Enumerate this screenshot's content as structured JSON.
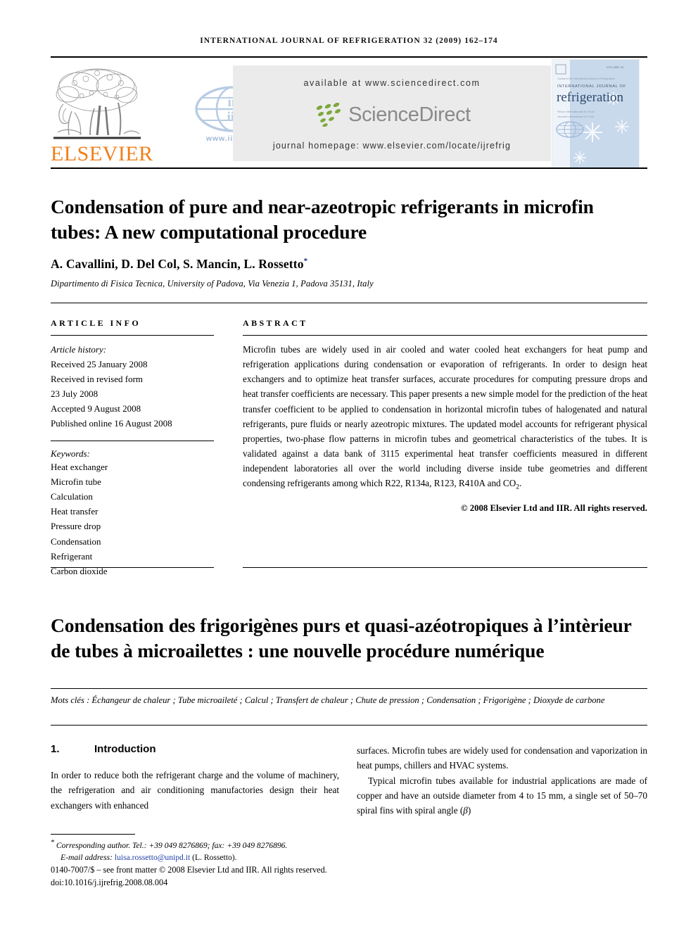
{
  "running_head": "INTERNATIONAL JOURNAL OF REFRIGERATION 32 (2009) 162–174",
  "masthead": {
    "publisher_wordmark": "ELSEVIER",
    "iir_url": "www.iifiir.org",
    "available_at": "available at www.sciencedirect.com",
    "sciencedirect_wordmark": "ScienceDirect",
    "journal_homepage": "journal homepage: www.elsevier.com/locate/ijrefrig",
    "cover": {
      "line_small": "INTERNATIONAL JOURNAL OF",
      "line_big": "refrigeration",
      "volume_tag": "VOLUME 32"
    },
    "colors": {
      "elsevier_orange": "#F07F1A",
      "sciencedirect_green": "#7DA83B",
      "iir_blue": "#b8cce4",
      "banner_grey": "#ebebeb",
      "cover_blue": "#c9d9ec"
    }
  },
  "article": {
    "title": "Condensation of pure and near-azeotropic refrigerants in microfin tubes: A new computational procedure",
    "authors": "A. Cavallini, D. Del Col, S. Mancin, L. Rossetto",
    "author_marker": "*",
    "affiliation": "Dipartimento di Fisica Tecnica, University of Padova, Via Venezia 1, Padova 35131, Italy"
  },
  "article_info": {
    "heading": "ARTICLE INFO",
    "history_label": "Article history:",
    "history": [
      "Received 25 January 2008",
      "Received in revised form",
      "23 July 2008",
      "Accepted 9 August 2008",
      "Published online 16 August 2008"
    ],
    "keywords_label": "Keywords:",
    "keywords": [
      "Heat exchanger",
      "Microfin tube",
      "Calculation",
      "Heat transfer",
      "Pressure drop",
      "Condensation",
      "Refrigerant",
      "Carbon dioxide"
    ]
  },
  "abstract": {
    "heading": "ABSTRACT",
    "paragraph_part1": "Microfin tubes are widely used in air cooled and water cooled heat exchangers for heat pump and refrigeration applications during condensation or evaporation of refrigerants. In order to design heat exchangers and to optimize heat transfer surfaces, accurate procedures for computing pressure drops and heat transfer coefficients are necessary. This paper presents a new simple model for the prediction of the heat transfer coefficient to be applied to condensation in horizontal microfin tubes of halogenated and natural refrigerants, pure fluids or nearly azeotropic mixtures. The updated model accounts for refrigerant physical properties, two-phase flow patterns in microfin tubes and geometrical characteristics of the tubes. It is validated against a data bank of 3115 experimental heat transfer coefficients measured in different independent laboratories all over the world including diverse inside tube geometries and different condensing refrigerants among which R22, R134a, R123, R410A and CO",
    "subscript": "2",
    "paragraph_end": ".",
    "copyright": "© 2008 Elsevier Ltd and IIR. All rights reserved."
  },
  "french": {
    "title": "Condensation des frigorigènes purs et quasi-azéotropiques à l’intèrieur de tubes à microailettes : une nouvelle procédure numérique",
    "keywords": "Mots clés : Échangeur de chaleur ; Tube microaileté ; Calcul ; Transfert de chaleur ; Chute de pression ; Condensation ; Frigorigène ; Dioxyde de carbone"
  },
  "introduction": {
    "number": "1.",
    "heading": "Introduction",
    "left_paragraph": "In order to reduce both the refrigerant charge and the volume of machinery, the refrigeration and air conditioning manufactories design their heat exchangers with enhanced",
    "right_paragraph_1": "surfaces. Microfin tubes are widely used for condensation and vaporization in heat pumps, chillers and HVAC systems.",
    "right_paragraph_2_pre": "Typical microfin tubes available for industrial applications are made of copper and have an outside diameter from 4 to 15 mm, a single set of 50–70 spiral fins with spiral angle (",
    "right_paragraph_2_symbol": "β",
    "right_paragraph_2_post": ")"
  },
  "footer": {
    "corresponding_marker": "*",
    "corresponding_author": "Corresponding author. Tel.: +39 049 8276869; fax: +39 049 8276896.",
    "email_label": "E-mail address:",
    "email": "luisa.rossetto@unipd.it",
    "email_owner": "(L. Rossetto).",
    "front_matter": "0140-7007/$ – see front matter © 2008 Elsevier Ltd and IIR. All rights reserved.",
    "doi": "doi:10.1016/j.ijrefrig.2008.08.004"
  }
}
